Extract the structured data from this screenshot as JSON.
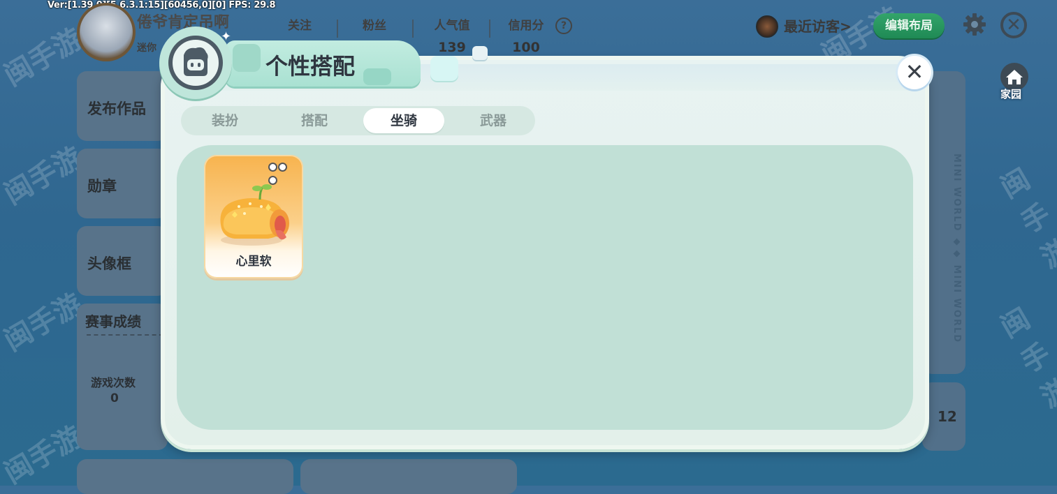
{
  "debug": "Ver:[1.39.0][5.6.3.1:15][60456,0][0] FPS: 29.8",
  "profile": {
    "username": "倦爷肯定吊啊",
    "subtitle": "迷你"
  },
  "stats": [
    {
      "label": "关注",
      "value": ""
    },
    {
      "label": "粉丝",
      "value": ""
    },
    {
      "label": "人气值",
      "value": "139"
    },
    {
      "label": "信用分",
      "value": "100"
    }
  ],
  "help_glyph": "?",
  "recent_visitors": "最近访客>",
  "edit_layout": "编辑布局",
  "home_label": "家园",
  "side_menu": {
    "publish": "发布作品",
    "medals": "勋章",
    "avatar_frame": "头像框"
  },
  "match_stats": {
    "title": "赛事成绩",
    "games_label": "游戏次数",
    "games_value": "0"
  },
  "right_panel": {
    "number": "12",
    "logo_text": "MINI WORLD ◆◆ MINI WORLD"
  },
  "watermark": "闽手游",
  "modal": {
    "title": "个性搭配",
    "close_glyph": "✕",
    "tabs": [
      {
        "label": "装扮",
        "active": false
      },
      {
        "label": "搭配",
        "active": false
      },
      {
        "label": "坐骑",
        "active": true
      },
      {
        "label": "武器",
        "active": false
      }
    ],
    "items": [
      {
        "name": "心里软",
        "icon": "bread-mount-icon"
      }
    ]
  },
  "colors": {
    "accent_green": "#1f8a55",
    "modal_bg": "#e3f0ea",
    "content_bg": "#c1e0d6",
    "title_tab": "#a9e1d2"
  }
}
